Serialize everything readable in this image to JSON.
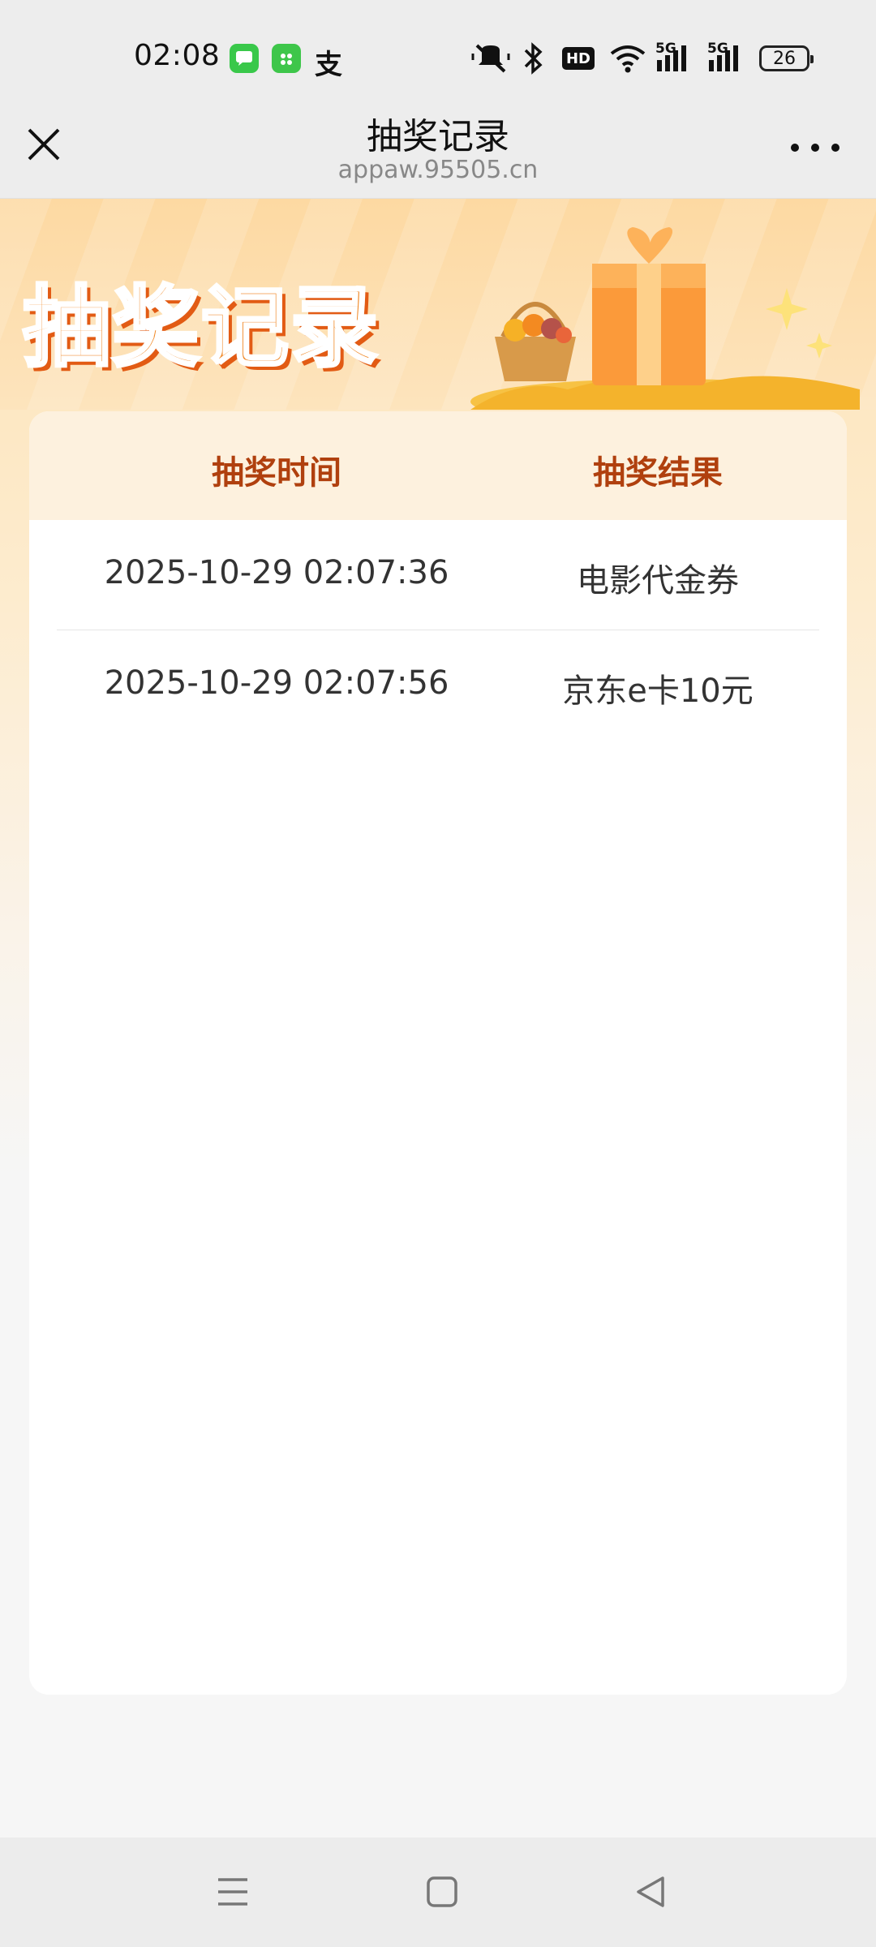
{
  "status_bar": {
    "time": "02:08",
    "notification_glyph": "支",
    "network_1": "5G",
    "network_2": "5G",
    "hd_label": "HD",
    "battery_level": "26"
  },
  "title_bar": {
    "title": "抽奖记录",
    "url": "appaw.95505.cn"
  },
  "banner": {
    "title": "抽奖记录"
  },
  "table": {
    "headers": [
      "抽奖时间",
      "抽奖结果"
    ],
    "rows": [
      {
        "time": "2025-10-29 02:07:36",
        "result": "电影代金券"
      },
      {
        "time": "2025-10-29 02:07:56",
        "result": "京东e卡10元"
      }
    ]
  },
  "colors": {
    "accent": "#f08a2a",
    "header_text": "#b0400e",
    "header_bg": "#fdf1de"
  },
  "icons": [
    "close-icon",
    "more-icon",
    "menu-icon",
    "home-icon",
    "back-icon",
    "mute-icon",
    "bluetooth-icon",
    "wifi-icon",
    "signal-icon",
    "battery-icon"
  ]
}
